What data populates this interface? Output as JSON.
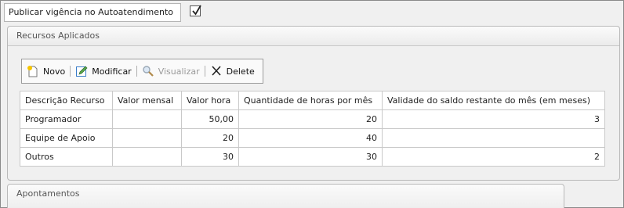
{
  "publish": {
    "label": "Publicar vigência no Autoatendimento",
    "checked": true
  },
  "recursos_panel": {
    "title": "Recursos Aplicados",
    "toolbar": {
      "novo_label": "Novo",
      "modificar_label": "Modificar",
      "visualizar_label": "Visualizar",
      "delete_label": "Delete"
    },
    "columns": [
      "Descrição Recurso",
      "Valor mensal",
      "Valor hora",
      "Quantidade de horas por mês",
      "Validade do saldo restante do mês (em meses)"
    ],
    "rows": [
      [
        "Programador",
        "",
        "50,00",
        "20",
        "3"
      ],
      [
        "Equipe de Apoio",
        "",
        "20",
        "40",
        ""
      ],
      [
        "Outros",
        "",
        "30",
        "30",
        "2"
      ]
    ]
  },
  "apontamentos_panel": {
    "title": "Apontamentos"
  }
}
